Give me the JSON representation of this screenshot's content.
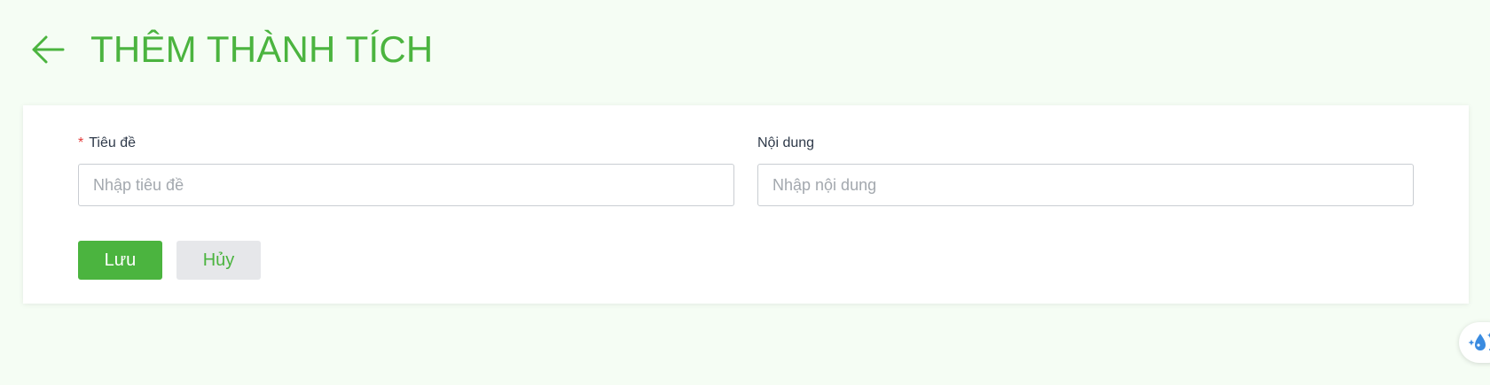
{
  "header": {
    "back_icon": "arrow-left-icon",
    "title": "THÊM THÀNH TÍCH"
  },
  "form": {
    "title_field": {
      "required_mark": "*",
      "label": "Tiêu đề",
      "placeholder": "Nhập tiêu đề",
      "value": ""
    },
    "content_field": {
      "label": "Nội dung",
      "placeholder": "Nhập nội dung",
      "value": ""
    },
    "actions": {
      "save_label": "Lưu",
      "cancel_label": "Hủy"
    }
  },
  "floating_widget": {
    "icon": "water-drop-sparkle-icon"
  },
  "colors": {
    "accent": "#4bb43f",
    "page_background": "#f5fdf4",
    "required": "#e33b3b",
    "cancel_background": "#e6e7ea"
  }
}
